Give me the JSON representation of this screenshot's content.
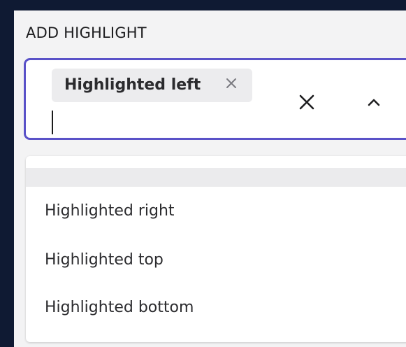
{
  "field": {
    "label": "ADD HIGHLIGHT"
  },
  "combo": {
    "selected_chips": [
      {
        "label": "Highlighted left"
      }
    ],
    "input_value": ""
  },
  "listbox": {
    "options": [
      {
        "label": ""
      },
      {
        "label": "Highlighted right"
      },
      {
        "label": "Highlighted top"
      },
      {
        "label": "Highlighted bottom"
      }
    ]
  },
  "icons": {
    "chip_remove": "close-icon",
    "clear": "close-icon",
    "toggle": "chevron-up-icon"
  },
  "colors": {
    "focus_border": "#5a52c8",
    "background": "#0f1a33",
    "panel": "#f3f3f4",
    "chip": "#ececee",
    "highlighted_option": "#ebebed"
  }
}
